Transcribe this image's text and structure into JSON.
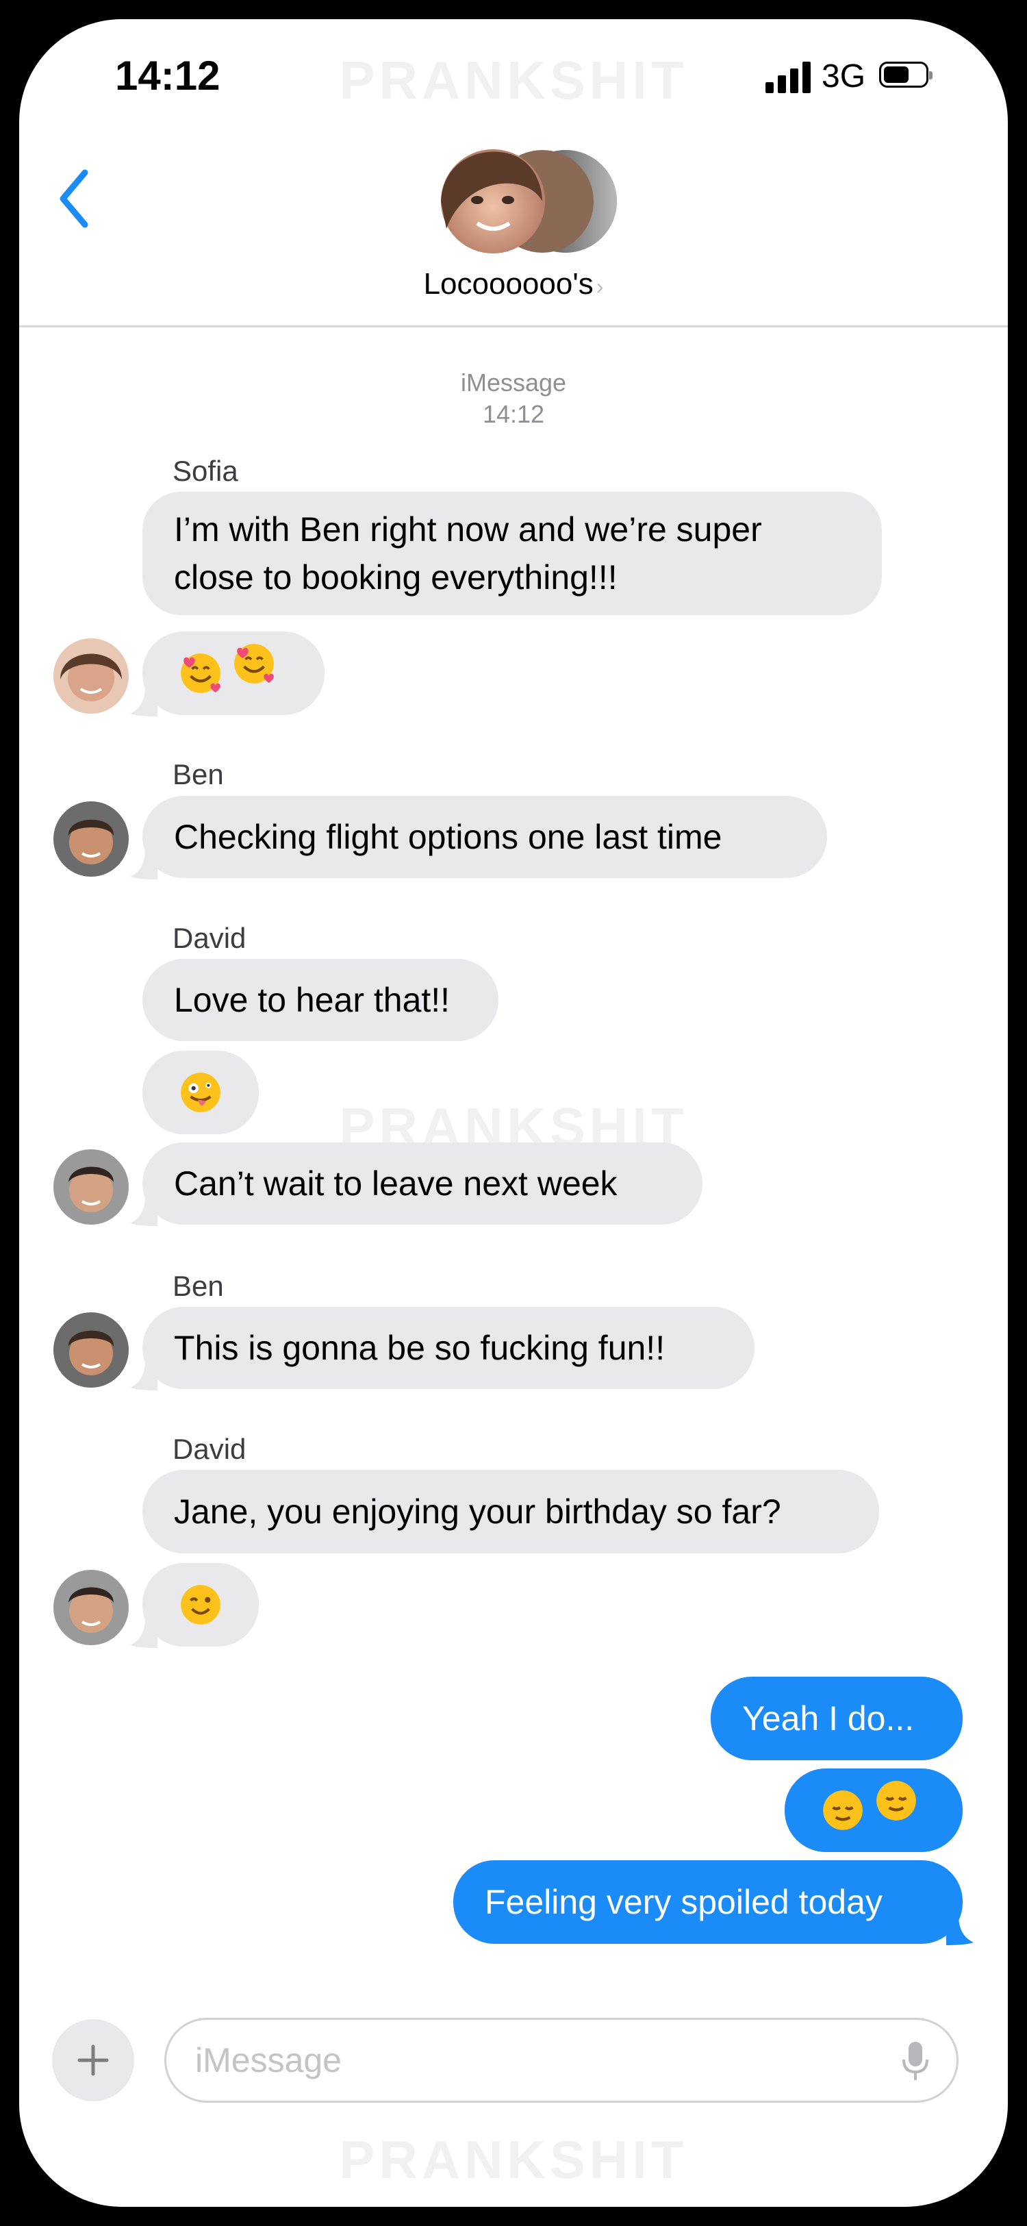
{
  "status": {
    "time": "14:12",
    "network": "3G"
  },
  "watermark": "PRANKSHIT",
  "header": {
    "group_name": "Locoooooo's",
    "chevron": "›"
  },
  "thread": {
    "service": "iMessage",
    "time": "14:12"
  },
  "messages": [
    {
      "sender": "Sofia",
      "text": "I’m with Ben right now and we’re super close to booking everything!!!"
    },
    {
      "emojis": "smiling-face-with-hearts x2"
    },
    {
      "sender": "Ben",
      "text": "Checking flight options one last time"
    },
    {
      "sender": "David",
      "text": "Love to hear that!!"
    },
    {
      "emojis": "zany-face"
    },
    {
      "text": "Can’t wait to leave next week"
    },
    {
      "sender": "Ben",
      "text": "This is gonna be so fucking fun!!"
    },
    {
      "sender": "David",
      "text": "Jane, you enjoying your birthday so far?"
    },
    {
      "emojis": "winking-face"
    },
    {
      "text": "Yeah I do..."
    },
    {
      "emojis": "relieved-face x2"
    },
    {
      "text": "Feeling very spoiled today"
    }
  ],
  "composer": {
    "placeholder": "iMessage"
  },
  "colors": {
    "accent": "#1b8cf7",
    "incoming_bubble": "#e9e9eb",
    "outgoing_bubble": "#1b8cf7"
  }
}
